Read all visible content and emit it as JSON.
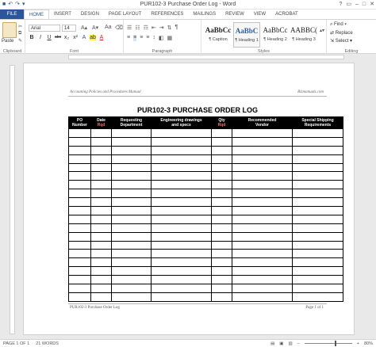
{
  "window": {
    "title": "PUR102-3 Purchase Order Log - Word",
    "controls": [
      "?",
      "▭",
      "–",
      "□",
      "✕"
    ]
  },
  "tabs": [
    "FILE",
    "HOME",
    "INSERT",
    "DESIGN",
    "PAGE LAYOUT",
    "REFERENCES",
    "MAILINGS",
    "REVIEW",
    "VIEW",
    "ACROBAT"
  ],
  "ribbon": {
    "clipboard": {
      "paste": "Paste",
      "label": "Clipboard"
    },
    "font": {
      "name": "Arial",
      "size": "14",
      "label": "Font",
      "buttons": [
        "B",
        "I",
        "U",
        "abc",
        "x₂",
        "x²",
        "A",
        "ab",
        "A"
      ]
    },
    "paragraph": {
      "label": "Paragraph"
    },
    "styles": {
      "label": "Styles",
      "items": [
        {
          "preview": "AaBbCc",
          "name": "¶ Caption"
        },
        {
          "preview": "AaBbC",
          "name": "¶ Heading 1"
        },
        {
          "preview": "AaBbCc",
          "name": "¶ Heading 2"
        },
        {
          "preview": "AABBC(",
          "name": "¶ Heading 3"
        }
      ]
    },
    "editing": {
      "label": "Editing",
      "find": "Find",
      "replace": "Replace",
      "select": "Select"
    }
  },
  "document": {
    "header_left": "Accounting Policies and Procedures Manual",
    "header_right": "Bizmanualz.com",
    "title": "PUR102-3 PURCHASE ORDER LOG",
    "columns": [
      {
        "l1": "PO",
        "l2": "Number",
        "red": false
      },
      {
        "l1": "Date",
        "l2": "Rqd",
        "red": true
      },
      {
        "l1": "Requesting",
        "l2": "Department",
        "red": false
      },
      {
        "l1": "Engineering drawings",
        "l2": "and specs",
        "red": false
      },
      {
        "l1": "Qty",
        "l2": "Rqd",
        "red": true
      },
      {
        "l1": "Recommended",
        "l2": "Vendor",
        "red": false
      },
      {
        "l1": "Special Shipping",
        "l2": "Requirements",
        "red": false
      }
    ],
    "footer_left": "PUR102-3 Purchase Order Log",
    "footer_right": "Page 1 of 1"
  },
  "status": {
    "page": "PAGE 1 OF 1",
    "words": "21 WORDS",
    "zoom": "80%"
  }
}
